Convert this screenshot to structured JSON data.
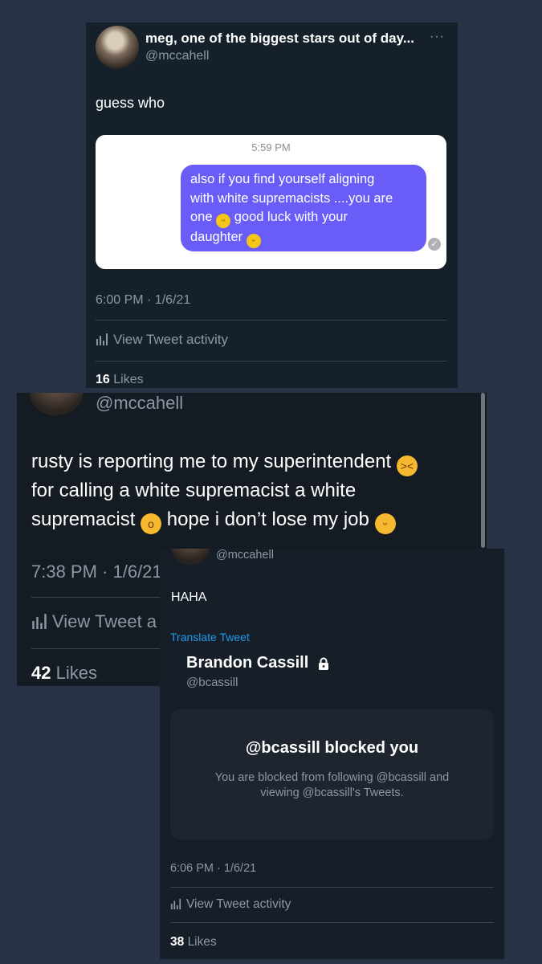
{
  "card1": {
    "name": "meg, one of the biggest stars out of day...",
    "handle": "@mccahell",
    "more": "···",
    "text": "guess who",
    "screenshot": {
      "time": "5:59 PM",
      "bubble_l1": "also if you find yourself aligning",
      "bubble_l2": "with white supremacists ....you are",
      "bubble_l3a": "one",
      "bubble_l3b": "good luck with your",
      "bubble_l4": "daughter",
      "emoji": "🙂"
    },
    "time": "6:00 PM · 1/6/21",
    "activity": "View Tweet activity",
    "likes_count": "16",
    "likes_label": "Likes"
  },
  "card2": {
    "handle": "@mccahell",
    "text_l1a": "rusty is reporting me to my superintendent",
    "emoji1": "😣",
    "text_l2": "for calling a white supremacist a white",
    "text_l3a": "supremacist",
    "emoji2": "😦",
    "text_l3b": "hope i don’t lose my job",
    "emoji3": "🤭",
    "time": "7:38 PM · 1/6/21",
    "activity": "View Tweet a",
    "likes_count": "42",
    "likes_label": "Likes"
  },
  "card3": {
    "handle": "@mccahell",
    "text": "HAHA",
    "translate": "Translate Tweet",
    "quoted_name": "Brandon Cassill",
    "quoted_handle": "@bcassill",
    "blocked_title": "@bcassill blocked you",
    "blocked_desc": "You are blocked from following @bcassill and viewing @bcassill's Tweets.",
    "time": "6:06 PM · 1/6/21",
    "activity": "View Tweet activity",
    "likes_count": "38",
    "likes_label": "Likes"
  },
  "colors": {
    "background": "#273246",
    "card": "#15202b",
    "bubble": "#6a5cf6",
    "link": "#1d9bf0"
  },
  "icons": [
    "more-icon",
    "bar-chart-icon",
    "lock-icon",
    "check-icon"
  ]
}
